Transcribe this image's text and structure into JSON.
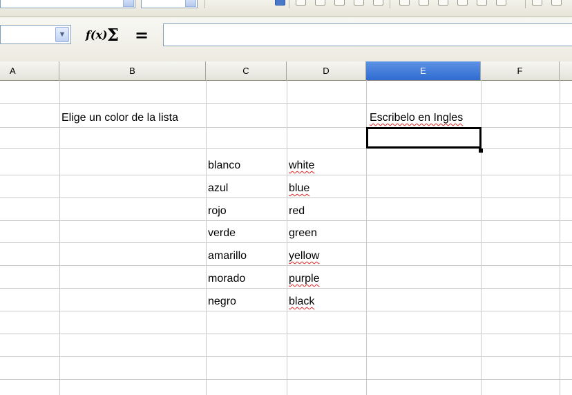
{
  "formula_bar": {
    "name_box_value": "",
    "formula_value": "",
    "icons": [
      "function-wizard-icon",
      "sum-icon",
      "equals-icon"
    ],
    "fx_glyph": "f(x)",
    "sum_glyph": "Σ",
    "equals_glyph": "="
  },
  "sheet": {
    "columns": [
      "A",
      "B",
      "C",
      "D",
      "E",
      "F"
    ],
    "active_column": "E",
    "active_color": "#3b78d8",
    "cells": {
      "B3": "Elige un color de la lista",
      "E3": "Escribelo en Ingles",
      "C5": "blanco",
      "D5": "white",
      "C6": "azul",
      "D6": "blue",
      "C7": "rojo",
      "D7": "red",
      "C8": "verde",
      "D8": "green",
      "C9": "amarillo",
      "D9": "yellow",
      "C10": "morado",
      "D10": "purple",
      "C11": "negro",
      "D11": "black"
    },
    "selected_cell": "E4",
    "spellcheck_color": "#e02020"
  }
}
